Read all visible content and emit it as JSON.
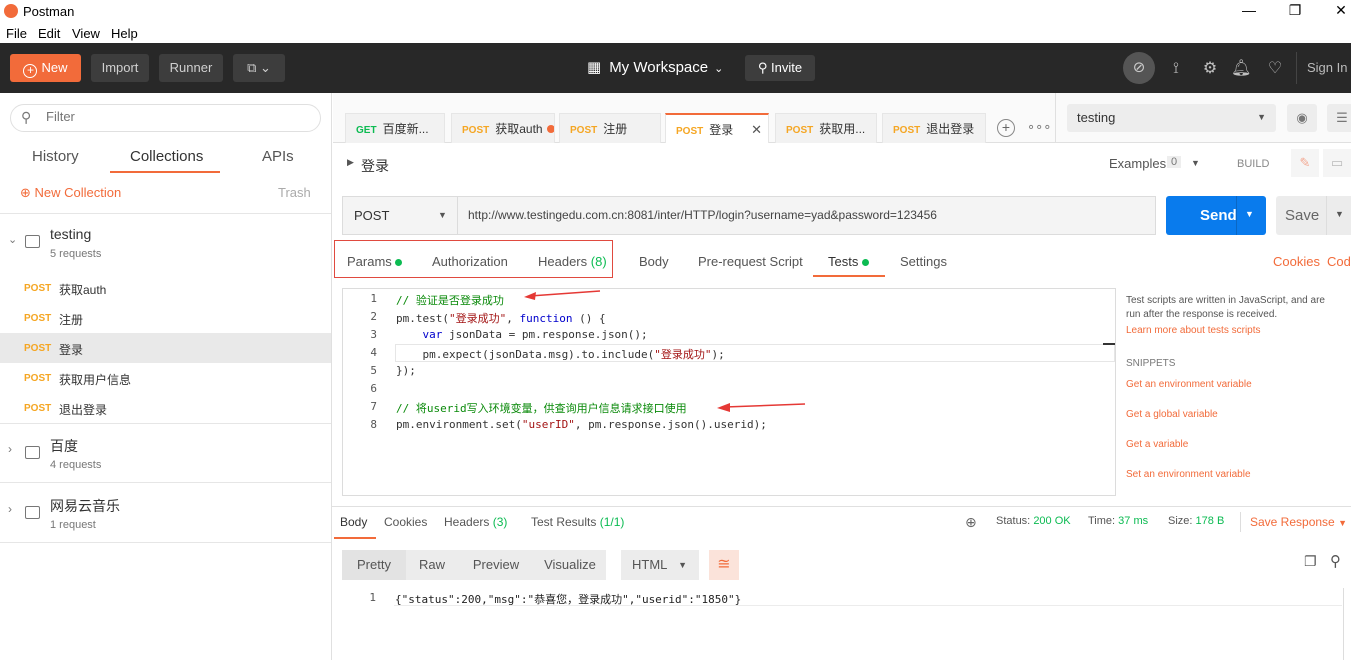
{
  "window": {
    "title": "Postman"
  },
  "menu": [
    "File",
    "Edit",
    "View",
    "Help"
  ],
  "header": {
    "new_label": "New",
    "import_label": "Import",
    "runner_label": "Runner",
    "workspace_label": "My Workspace",
    "invite_label": "Invite",
    "signin_label": "Sign In"
  },
  "sidebar": {
    "filter_placeholder": "Filter",
    "tabs": [
      "History",
      "Collections",
      "APIs"
    ],
    "new_collection": "New Collection",
    "trash": "Trash",
    "collections": [
      {
        "name": "testing",
        "count": "5 requests"
      },
      {
        "name": "百度",
        "count": "4 requests"
      },
      {
        "name": "网易云音乐",
        "count": "1 request"
      }
    ],
    "requests": [
      {
        "method": "POST",
        "name": "获取auth"
      },
      {
        "method": "POST",
        "name": "注册"
      },
      {
        "method": "POST",
        "name": "登录"
      },
      {
        "method": "POST",
        "name": "获取用户信息"
      },
      {
        "method": "POST",
        "name": "退出登录"
      }
    ]
  },
  "tabs": [
    {
      "method": "GET",
      "name": "百度新..."
    },
    {
      "method": "POST",
      "name": "获取auth"
    },
    {
      "method": "POST",
      "name": "注册"
    },
    {
      "method": "POST",
      "name": "登录"
    },
    {
      "method": "POST",
      "name": "获取用..."
    },
    {
      "method": "POST",
      "name": "退出登录"
    }
  ],
  "environment": {
    "selected": "testing"
  },
  "request": {
    "name": "登录",
    "examples_label": "Examples",
    "examples_count": "0",
    "build_label": "BUILD",
    "method": "POST",
    "url": "http://www.testingedu.com.cn:8081/inter/HTTP/login?username=yad&password=123456",
    "send_label": "Send",
    "save_label": "Save"
  },
  "request_tabs": {
    "params": "Params",
    "authorization": "Authorization",
    "headers": "Headers",
    "headers_count": "(8)",
    "body": "Body",
    "prerequest": "Pre-request Script",
    "tests": "Tests",
    "settings": "Settings",
    "cookies": "Cookies",
    "code": "Code"
  },
  "editor": {
    "line_numbers": [
      "1",
      "2",
      "3",
      "4",
      "5",
      "6",
      "7",
      "8"
    ],
    "l1": "// 验证是否登录成功",
    "l2a": "pm.test(",
    "l2b": "\"登录成功\"",
    "l2c": ", ",
    "l2d": "function",
    "l2e": " () {",
    "l3a": "    ",
    "l3b": "var",
    "l3c": " jsonData = pm.response.json();",
    "l4a": "    pm.expect(jsonData.msg).to.include(",
    "l4b": "\"登录成功\"",
    "l4c": ");",
    "l5": "});",
    "l7": "// 将userid写入环境变量，供查询用户信息请求接口使用",
    "l8a": "pm.environment.set(",
    "l8b": "\"userID\"",
    "l8c": ", pm.response.json().userid);"
  },
  "snippets": {
    "description": "Test scripts are written in JavaScript, and are run after the response is received.",
    "learn_more": "Learn more about tests scripts",
    "heading": "SNIPPETS",
    "items": [
      "Get an environment variable",
      "Get a global variable",
      "Get a variable",
      "Set an environment variable"
    ]
  },
  "response": {
    "tabs": {
      "body": "Body",
      "cookies": "Cookies",
      "headers": "Headers",
      "headers_count": "(3)",
      "tests": "Test Results",
      "tests_count": "(1/1)"
    },
    "status_label": "Status:",
    "status_value": "200 OK",
    "time_label": "Time:",
    "time_value": "37 ms",
    "size_label": "Size:",
    "size_value": "178 B",
    "save_response": "Save Response",
    "view_buttons": [
      "Pretty",
      "Raw",
      "Preview",
      "Visualize"
    ],
    "format": "HTML",
    "line_number": "1",
    "body_text": "{\"status\":200,\"msg\":\"恭喜您，登录成功\",\"userid\":\"1850\"}"
  },
  "colors": {
    "accent": "#f26b3a",
    "send": "#097bed",
    "post": "#f5a623",
    "status_ok": "#0cbb52"
  }
}
